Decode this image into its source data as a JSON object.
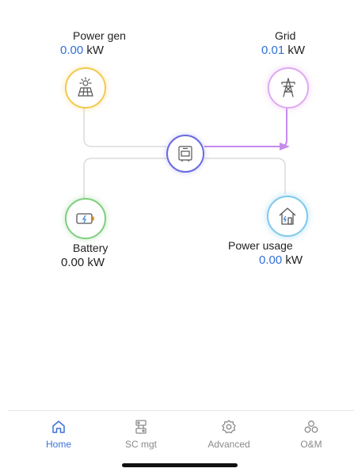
{
  "flow": {
    "power_gen": {
      "label": "Power gen",
      "value": "0.00",
      "unit": "kW"
    },
    "grid": {
      "label": "Grid",
      "value": "0.01",
      "unit": "kW"
    },
    "battery": {
      "label": "Battery",
      "value": "0.00",
      "unit": "kW"
    },
    "power_usage": {
      "label": "Power usage",
      "value": "0.00",
      "unit": "kW"
    }
  },
  "icons": {
    "power_gen": "solar-panel-icon",
    "grid": "transmission-tower-icon",
    "inverter": "inverter-icon",
    "battery": "battery-charging-icon",
    "power_usage": "house-power-icon"
  },
  "colors": {
    "accent": "#2f6fd8",
    "active_flow": "#c58af0",
    "idle_line": "#dcdcdc",
    "power_gen_ring": "#f2c94c",
    "grid_ring": "#e0a8f2",
    "battery_ring": "#7fcf7f",
    "usage_ring": "#7fc9ec",
    "inverter_ring": "#6a6ae0"
  },
  "tabbar": {
    "items": [
      {
        "label": "Home",
        "icon": "home-icon",
        "active": true
      },
      {
        "label": "SC mgt",
        "icon": "sc-mgt-icon",
        "active": false
      },
      {
        "label": "Advanced",
        "icon": "gear-icon",
        "active": false
      },
      {
        "label": "O&M",
        "icon": "om-icon",
        "active": false
      }
    ]
  }
}
